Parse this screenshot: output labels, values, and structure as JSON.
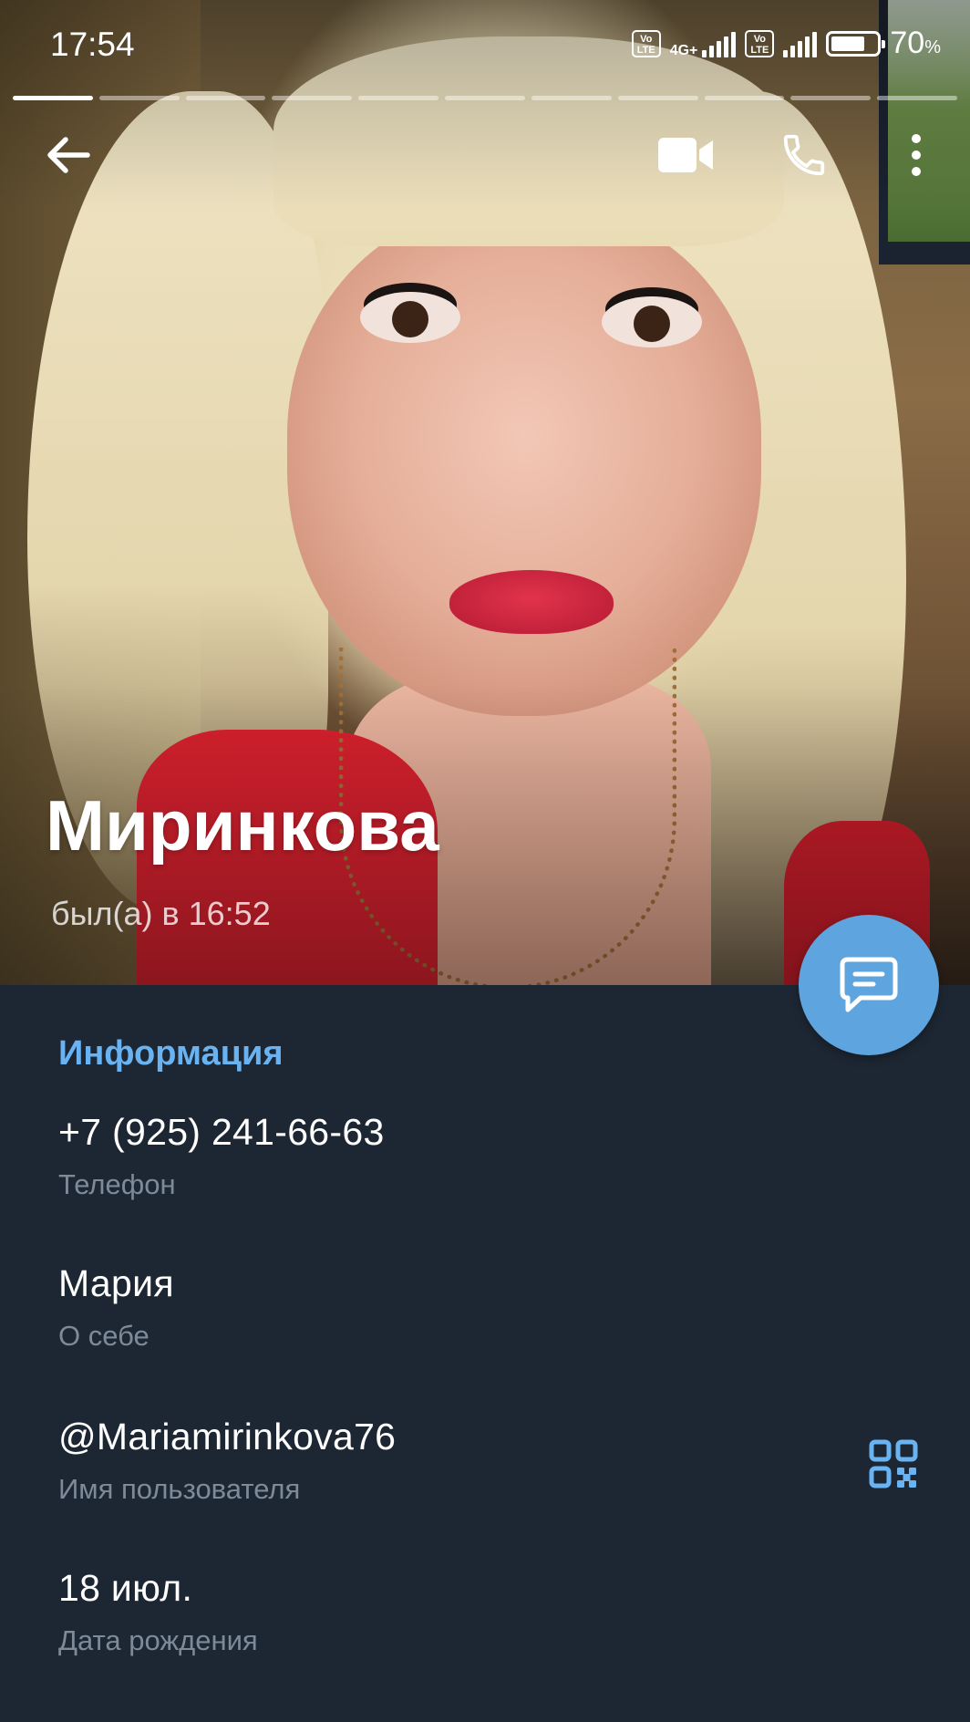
{
  "status_bar": {
    "time": "17:54",
    "network_type": "4G+",
    "volte_label": "Vo LTE",
    "battery_percent": "70",
    "battery_unit": "%"
  },
  "story": {
    "segments_total": 11,
    "active_index": 0
  },
  "toolbar": {
    "back_icon": "arrow-left-icon",
    "video_icon": "video-camera-icon",
    "call_icon": "phone-icon",
    "more_icon": "more-vertical-icon"
  },
  "profile": {
    "name": "Миринкова",
    "last_seen": "был(а) в 16:52"
  },
  "fab": {
    "icon": "message-icon",
    "color": "#5ea4de"
  },
  "info": {
    "header": "Информация",
    "rows": [
      {
        "value": "+7 (925) 241-66-63",
        "label": "Телефон"
      },
      {
        "value": "Мария",
        "label": "О себе"
      },
      {
        "value": "@Mariamirinkova76",
        "label": "Имя пользователя"
      },
      {
        "value": "18 июл.",
        "label": "Дата рождения"
      }
    ]
  },
  "colors": {
    "background": "#1d2733",
    "accent": "#6ab3f3",
    "secondary_text": "#7d8b99"
  }
}
